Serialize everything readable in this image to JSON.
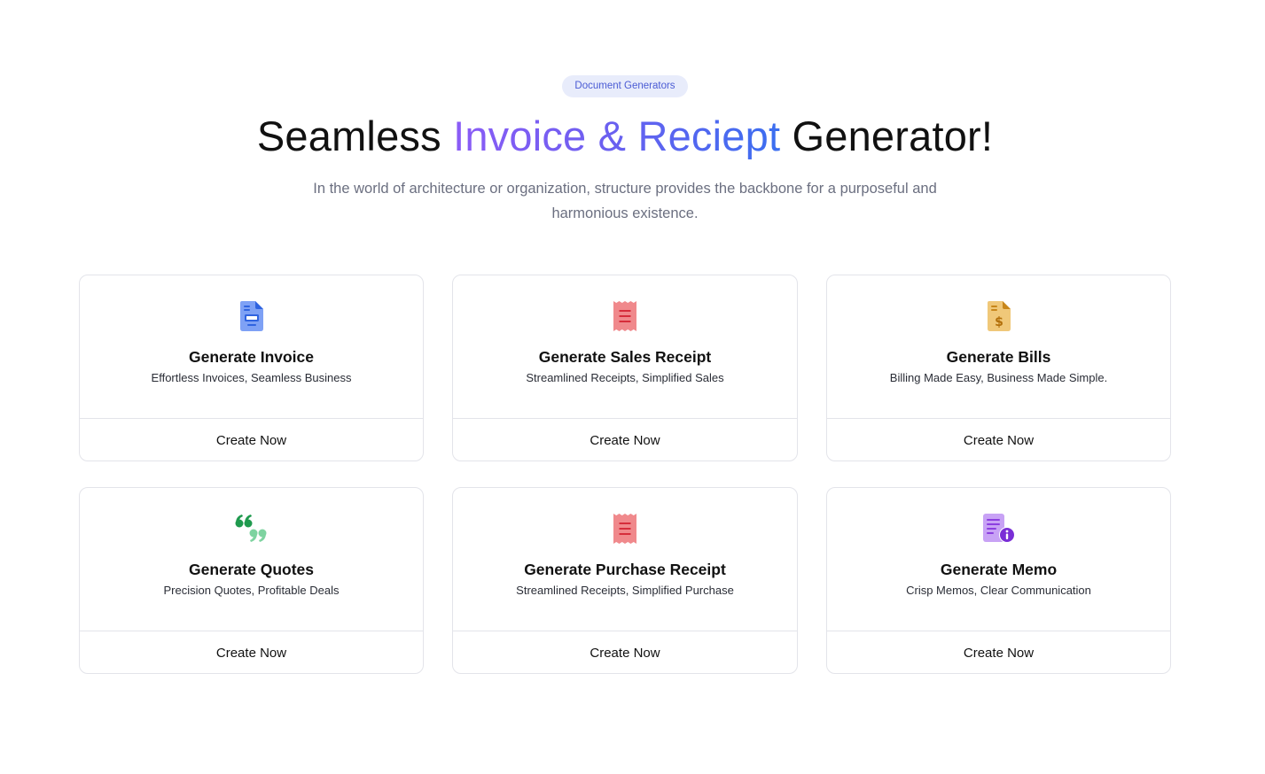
{
  "badge": "Document Generators",
  "heading": {
    "before": "Seamless ",
    "highlight": "Invoice & Reciept",
    "after": " Generator!"
  },
  "subtitle": "In the world of architecture or organization, structure provides the backbone for a purposeful and harmonious existence.",
  "colors": {
    "badge_bg": "#e8ecfb",
    "badge_text": "#4a5bd4",
    "gradient_start": "#8b5cf6",
    "gradient_end": "#3b6ef0",
    "card_border": "#e3e4ea"
  },
  "cards": [
    {
      "icon": "invoice-document-icon",
      "title": "Generate Invoice",
      "description": "Effortless Invoices, Seamless Business",
      "action": "Create Now"
    },
    {
      "icon": "sales-receipt-icon",
      "title": "Generate Sales Receipt",
      "description": "Streamlined Receipts, Simplified Sales",
      "action": "Create Now"
    },
    {
      "icon": "bill-dollar-icon",
      "title": "Generate Bills",
      "description": "Billing Made Easy, Business Made Simple.",
      "action": "Create Now"
    },
    {
      "icon": "quote-marks-icon",
      "title": "Generate Quotes",
      "description": "Precision Quotes, Profitable Deals",
      "action": "Create Now"
    },
    {
      "icon": "purchase-receipt-icon",
      "title": "Generate Purchase Receipt",
      "description": "Streamlined Receipts, Simplified Purchase",
      "action": "Create Now"
    },
    {
      "icon": "memo-info-icon",
      "title": "Generate Memo",
      "description": "Crisp Memos, Clear Communication",
      "action": "Create Now"
    }
  ]
}
